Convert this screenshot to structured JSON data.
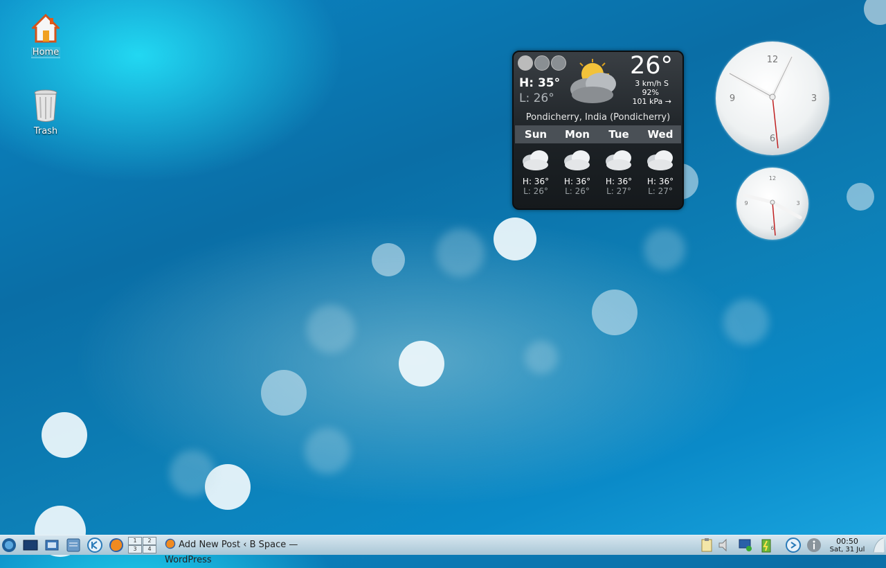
{
  "desktop": {
    "icons": [
      {
        "label": "Home",
        "icon": "home-folder-icon"
      },
      {
        "label": "Trash",
        "icon": "trash-icon"
      }
    ]
  },
  "weather": {
    "current_temp": "26°",
    "high": "H: 35°",
    "low": "L: 26°",
    "wind": "3 km/h S",
    "humidity": "92%",
    "pressure": "101 kPa →",
    "location": "Pondicherry, India (Pondicherry)",
    "condition_icon": "partly-cloudy-icon",
    "forecast": [
      {
        "day": "Sun",
        "high": "H: 36°",
        "low": "L: 26°",
        "icon": "cloudy-icon"
      },
      {
        "day": "Mon",
        "high": "H: 36°",
        "low": "L: 26°",
        "icon": "cloudy-icon"
      },
      {
        "day": "Tue",
        "high": "H: 36°",
        "low": "L: 27°",
        "icon": "cloudy-icon"
      },
      {
        "day": "Wed",
        "high": "H: 36°",
        "low": "L: 27°",
        "icon": "cloudy-icon"
      }
    ]
  },
  "clocks": {
    "large": {
      "n12": "12",
      "n3": "3",
      "n6": "6",
      "n9": "9"
    },
    "small": {
      "n12": "12",
      "n3": "3",
      "n6": "6",
      "n9": "9"
    }
  },
  "taskbar": {
    "pager": [
      "1",
      "2",
      "3",
      "4"
    ],
    "task_title": "Add New Post ‹ B Space — WordPress",
    "time": "00:50",
    "date": "Sat, 31 Jul",
    "accent": "#1e88c8"
  }
}
